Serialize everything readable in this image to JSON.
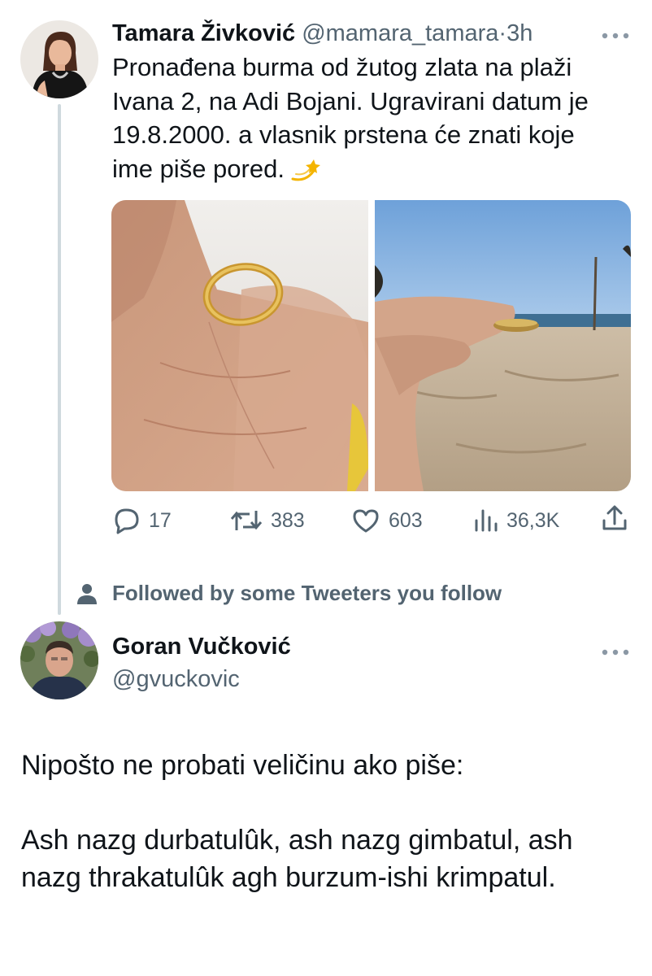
{
  "tweet": {
    "author_name": "Tamara Živković",
    "author_handle": "@mamara_tamara",
    "separator": "·",
    "time": "3h",
    "text": "Pronađena burma od žutog zlata na plaži Ivana 2, na Adi Bojani. Ugravirani datum je 19.8.2000. a vlasnik prstena će znati koje ime piše pored.",
    "emoji": "dizzy-emoji",
    "more_icon": "more-icon",
    "stats": {
      "replies": "17",
      "retweets": "383",
      "likes": "603",
      "views": "36,3K"
    },
    "icons": {
      "reply": "reply-icon",
      "retweet": "retweet-icon",
      "like": "heart-icon",
      "views": "views-icon",
      "share": "share-icon"
    }
  },
  "social_context": {
    "icon": "person-icon",
    "text": "Followed by some Tweeters you follow"
  },
  "reply": {
    "author_name": "Goran Vučković",
    "author_handle": "@gvuckovic",
    "more_icon": "more-icon",
    "line1": "Nipošto ne probati veličinu ako piše:",
    "line2": "Ash nazg durbatulûk, ash nazg gimbatul, ash nazg thrakatulûk agh burzum-ishi krimpatul."
  },
  "colors": {
    "text_primary": "#0f1419",
    "text_secondary": "#536471",
    "thread_line": "#cfd9de"
  }
}
